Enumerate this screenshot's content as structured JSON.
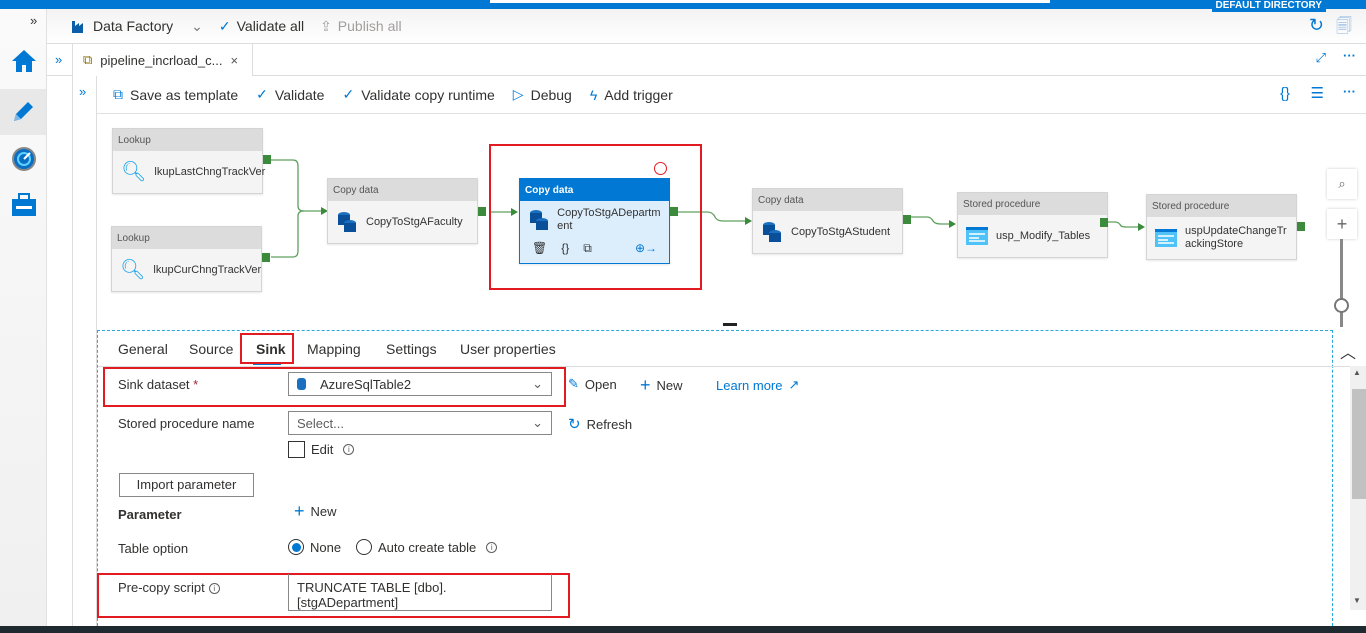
{
  "header": {
    "directory": "DEFAULT DIRECTORY"
  },
  "factorybar": {
    "factory": "Data Factory",
    "validate_all": "Validate all",
    "publish_all": "Publish all"
  },
  "tab": {
    "title": "pipeline_incrload_c...",
    "close": "×"
  },
  "pipeline_toolbar": {
    "save_template": "Save as template",
    "validate": "Validate",
    "validate_runtime": "Validate copy runtime",
    "debug": "Debug",
    "add_trigger": "Add trigger"
  },
  "activities": [
    {
      "type": "Lookup",
      "name": "lkupLastChngTrackVer"
    },
    {
      "type": "Lookup",
      "name": "lkupCurChngTrackVer"
    },
    {
      "type": "Copy data",
      "name": "CopyToStgAFaculty"
    },
    {
      "type": "Copy data",
      "name": "CopyToStgADepartment",
      "selected": true
    },
    {
      "type": "Copy data",
      "name": "CopyToStgAStudent"
    },
    {
      "type": "Stored procedure",
      "name": "usp_Modify_Tables"
    },
    {
      "type": "Stored procedure",
      "name": "uspUpdateChangeTrackingStore"
    }
  ],
  "panel": {
    "tabs": [
      "General",
      "Source",
      "Sink",
      "Mapping",
      "Settings",
      "User properties"
    ],
    "active_tab": "Sink",
    "sink_dataset_label": "Sink dataset",
    "required_mark": "*",
    "sink_dataset_value": "AzureSqlTable2",
    "open": "Open",
    "new": "New",
    "learn_more": "Learn more",
    "sp_label": "Stored procedure name",
    "sp_placeholder": "Select...",
    "refresh": "Refresh",
    "edit": "Edit",
    "import_parameter": "Import parameter",
    "parameter_label": "Parameter",
    "parameter_new": "New",
    "table_option_label": "Table option",
    "table_option_none": "None",
    "table_option_auto": "Auto create table",
    "table_option_selected": "None",
    "precopy_label": "Pre-copy script",
    "precopy_value": "TRUNCATE TABLE [dbo].[stgADepartment]"
  },
  "colors": {
    "accent": "#0078d4",
    "highlight": "#e21b23",
    "connector": "#3c8a3c"
  }
}
